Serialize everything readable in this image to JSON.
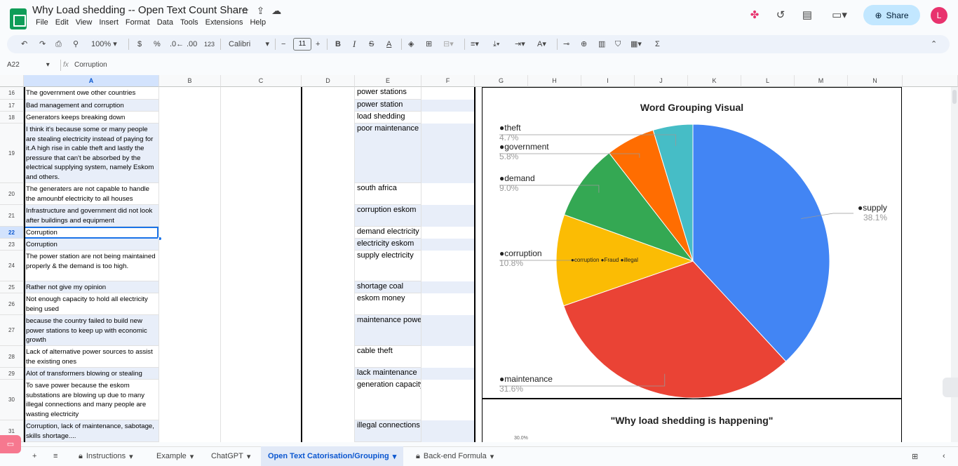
{
  "header": {
    "title": "Why  Load shedding -- Open Text Count Share",
    "menu": [
      "File",
      "Edit",
      "View",
      "Insert",
      "Format",
      "Data",
      "Tools",
      "Extensions",
      "Help"
    ],
    "share_label": "Share",
    "avatar_letter": "L"
  },
  "toolbar": {
    "zoom": "100%",
    "currency": "$",
    "percent": "%",
    "dec_decrease": ".0←",
    "dec_increase": ".00",
    "num_format": "123",
    "font": "Calibri",
    "font_size": "11"
  },
  "formula_bar": {
    "name_box": "A22",
    "fx": "fx",
    "content": "Corruption"
  },
  "columns": [
    "A",
    "B",
    "C",
    "D",
    "E",
    "F",
    "G",
    "H",
    "I",
    "J",
    "K",
    "L",
    "M",
    "N"
  ],
  "rows": [
    {
      "num": "16",
      "a": "The government owe other countries",
      "e": "power stations"
    },
    {
      "num": "17",
      "a": "Bad management and corruption",
      "e": "power station"
    },
    {
      "num": "18",
      "a": "Generators keeps breaking down",
      "e": "load shedding"
    },
    {
      "num": "19",
      "a": "I think it's because some or many people are stealing electricity instead of paying for it.A high rise in cable theft and lastly the pressure that can't be absorbed by the electrical supplying system, namely Eskom and others.",
      "e": "poor maintenance"
    },
    {
      "num": "20",
      "a": "The generaters are not capable to handle the amounbf electricity to all houses",
      "e": "south africa"
    },
    {
      "num": "21",
      "a": "Infrastructure and government did not look after buildings and equipment",
      "e": "corruption eskom"
    },
    {
      "num": "22",
      "a": "Corruption",
      "e": "demand electricity"
    },
    {
      "num": "23",
      "a": "Corruption",
      "e": "electricity eskom"
    },
    {
      "num": "24",
      "a": "The power station are not being maintained properly & the demand is too high.",
      "e": "supply electricity"
    },
    {
      "num": "25",
      "a": "Rather not give my opinion",
      "e": "shortage coal"
    },
    {
      "num": "26",
      "a": "Not enough capacity to hold all electricity being used",
      "e": "eskom money"
    },
    {
      "num": "27",
      "a": "because the country failed to build new power stations to keep up with economic growth",
      "e": "maintenance power"
    },
    {
      "num": "28",
      "a": "Lack of alternative power sources to assist the existing ones",
      "e": "cable theft"
    },
    {
      "num": "29",
      "a": "Alot of transformers blowing or stealing",
      "e": "lack maintenance"
    },
    {
      "num": "30",
      "a": "To save power because the eskom substations are blowing up due to many illegal connections and many people are wasting electricity",
      "e": "generation capacity"
    },
    {
      "num": "31",
      "a": "Corruption,  lack of maintenance, sabotage,  skills shortage....",
      "e": "illegal connections"
    }
  ],
  "chart_data": {
    "type": "pie",
    "title": "Word Grouping Visual",
    "labels": [
      "●supply",
      "●maintenance",
      "●corruption",
      "●demand",
      "●government",
      "●theft"
    ],
    "values": [
      38.1,
      31.6,
      10.8,
      9.0,
      5.8,
      4.7
    ],
    "value_labels": [
      "38.1%",
      "31.6%",
      "10.8%",
      "9.0%",
      "5.8%",
      "4.7%"
    ],
    "colors": [
      "#4285f4",
      "#ea4335",
      "#fbbc04",
      "#34a853",
      "#ff6d01",
      "#46bdc6"
    ],
    "annotation": "●corruption ●Fraud ●illegal"
  },
  "chart2": {
    "title": "\"Why load shedding is happening\"",
    "tick": "30.0%"
  },
  "tabs": [
    {
      "label": "Instructions",
      "locked": true
    },
    {
      "label": "Example"
    },
    {
      "label": "ChatGPT"
    },
    {
      "label": "Open Text Catorisation/Grouping",
      "active": true
    },
    {
      "label": "Back-end Formula",
      "locked": true
    }
  ]
}
